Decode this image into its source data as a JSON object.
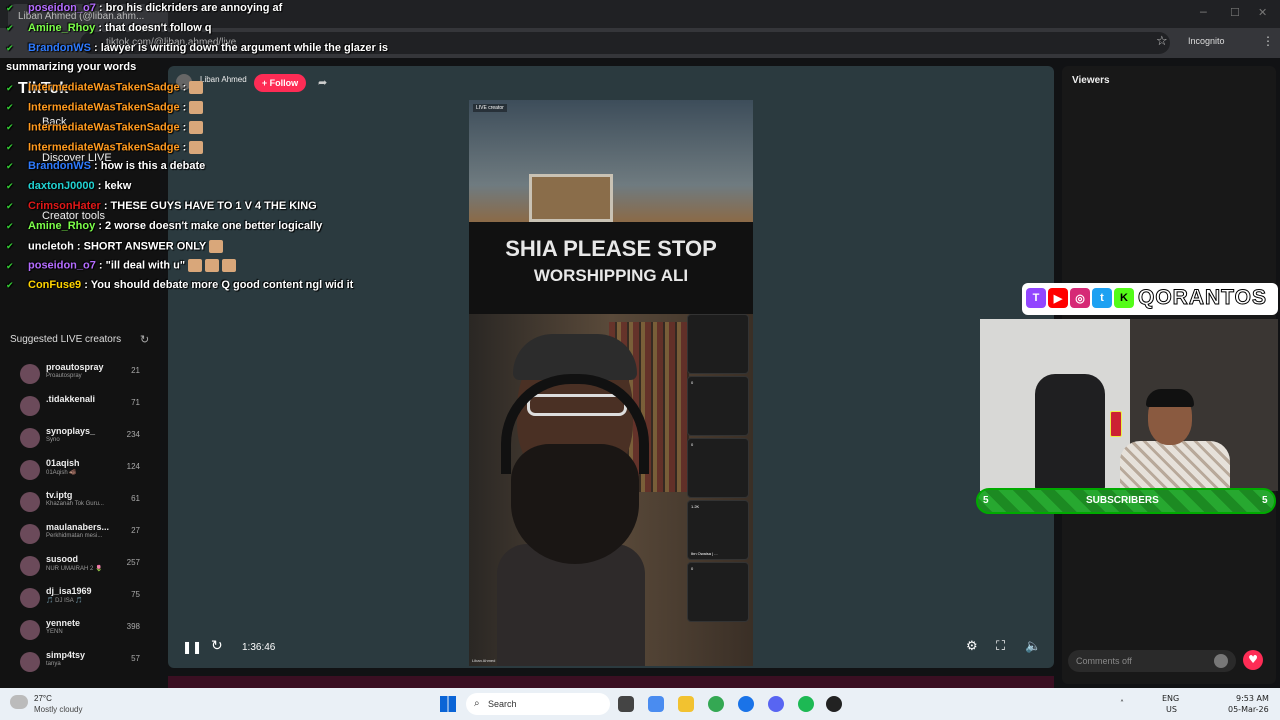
{
  "browser": {
    "tab_title": "Liban Ahmed (@liban.ahm...",
    "url": "tiktok.com/@liban.ahmed/live",
    "incognito_label": "Incognito"
  },
  "sidebar": {
    "logo": "TikTok",
    "nav": [
      {
        "label": "Back"
      },
      {
        "label": "Discover LIVE"
      },
      {
        "label": "Creator tools"
      }
    ],
    "suggested_title": "Suggested LIVE creators",
    "creators": [
      {
        "name": "proautospray",
        "sub": "Proautospray",
        "viewers": "21"
      },
      {
        "name": ".tidakkenali",
        "sub": "",
        "viewers": "71"
      },
      {
        "name": "synoplays_",
        "sub": "Syno",
        "viewers": "234"
      },
      {
        "name": "01aqish",
        "sub": "01Aqish 🐗",
        "viewers": "124"
      },
      {
        "name": "tv.iptg",
        "sub": "Khazanah Tok Guru...",
        "viewers": "61"
      },
      {
        "name": "maulanabers...",
        "sub": "Perkhidmatan mesi...",
        "viewers": "27"
      },
      {
        "name": "susood",
        "sub": "NUR UMAIRAH 2 🌷",
        "viewers": "257"
      },
      {
        "name": "dj_isa1969",
        "sub": "🎵 DJ ISA 🎵",
        "viewers": "75"
      },
      {
        "name": "yennete",
        "sub": "YENN",
        "viewers": "398"
      },
      {
        "name": "simp4tsy",
        "sub": "tanya",
        "viewers": "57"
      }
    ]
  },
  "live": {
    "host_name": "Liban Ahmed",
    "follow_label": "+ Follow",
    "banner_line1": "SHIA PLEASE STOP",
    "banner_line2": "WORSHIPPING ALI",
    "live_tag": "LIVE creator",
    "host_caption": "Liban Ahmed",
    "guests": [
      {
        "count": "",
        "label": ""
      },
      {
        "count": "0",
        "label": ""
      },
      {
        "count": "0",
        "label": ""
      },
      {
        "count": "1.2K",
        "label": "Ibn Owaisa | ..."
      },
      {
        "count": "0",
        "label": ""
      }
    ],
    "elapsed": "1:36:46"
  },
  "right_panel": {
    "viewers_title": "Viewers",
    "comments_placeholder": "Comments off"
  },
  "overlay": {
    "brand": "QORANTOS",
    "socials": [
      "twitch-icon",
      "youtube-icon",
      "instagram-icon",
      "twitter-icon",
      "kick-icon"
    ],
    "subs_left": "5",
    "subs_label": "SUBSCRIBERS",
    "subs_right": "5"
  },
  "chat": [
    {
      "user": "poseidon_o7",
      "color": "#b46cff",
      "text": ": bro his dickriders are annoying af",
      "emotes": 0
    },
    {
      "user": "Amine_Rhoy",
      "color": "#7cff4a",
      "text": ": that doesn't follow q",
      "emotes": 0
    },
    {
      "user": "BrandonWS",
      "color": "#2f7bff",
      "text": ": lawyer is writing down the argument while the glazer is",
      "emotes": 0
    },
    {
      "user": "",
      "color": "#ffffff",
      "text": "summarizing your words",
      "emotes": 0
    },
    {
      "user": "IntermediateWasTakenSadge",
      "color": "#ff9a1f",
      "text": ":",
      "emotes": 1
    },
    {
      "user": "IntermediateWasTakenSadge",
      "color": "#ff9a1f",
      "text": ":",
      "emotes": 1
    },
    {
      "user": "IntermediateWasTakenSadge",
      "color": "#ff9a1f",
      "text": ":",
      "emotes": 1
    },
    {
      "user": "IntermediateWasTakenSadge",
      "color": "#ff9a1f",
      "text": ":",
      "emotes": 1
    },
    {
      "user": "BrandonWS",
      "color": "#2f7bff",
      "text": ": how is this a debate",
      "emotes": 0
    },
    {
      "user": "daxtonJ0000",
      "color": "#22d3d3",
      "text": ": kekw",
      "emotes": 0
    },
    {
      "user": "CrimsonHater",
      "color": "#e01818",
      "text": ": THESE GUYS HAVE TO 1 V 4 THE KING",
      "emotes": 0
    },
    {
      "user": "Amine_Rhoy",
      "color": "#7cff4a",
      "text": ": 2 worse doesn't make one better logically",
      "emotes": 0
    },
    {
      "user": "uncletoh",
      "color": "#ffffff",
      "text": ": SHORT ANSWER ONLY",
      "emotes": 1
    },
    {
      "user": "poseidon_o7",
      "color": "#b46cff",
      "text": ": \"ill deal with u\"",
      "emotes": 3
    },
    {
      "user": "ConFuse9",
      "color": "#ffd400",
      "text": ": You should debate more Q good content ngl wid it",
      "emotes": 0
    }
  ],
  "taskbar": {
    "temperature": "27°C",
    "condition": "Mostly cloudy",
    "search_placeholder": "Search",
    "lang_top": "ENG",
    "lang_bottom": "US",
    "time": "9:53 AM",
    "date": "05-Mar-26"
  }
}
